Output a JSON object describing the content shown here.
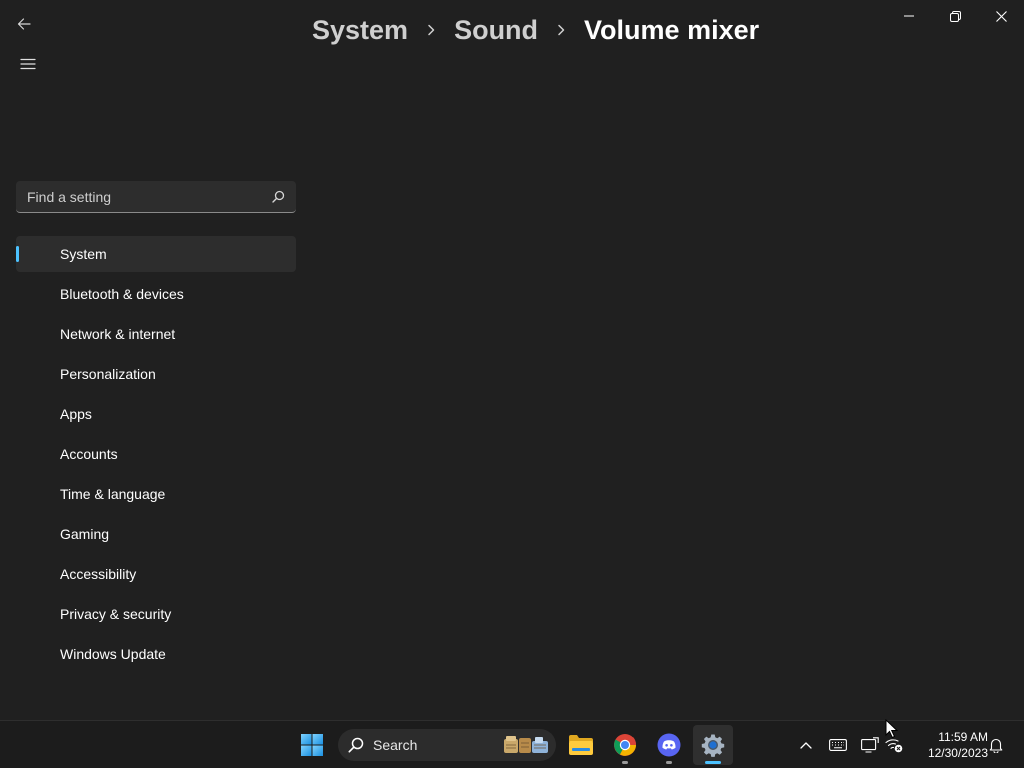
{
  "window": {
    "breadcrumb": [
      {
        "label": "System"
      },
      {
        "label": "Sound"
      },
      {
        "label": "Volume mixer"
      }
    ],
    "controls": [
      "minimize-icon",
      "restore-icon",
      "close-icon"
    ]
  },
  "search": {
    "placeholder": "Find a setting"
  },
  "nav": {
    "items": [
      {
        "label": "System",
        "selected": true
      },
      {
        "label": "Bluetooth & devices"
      },
      {
        "label": "Network & internet"
      },
      {
        "label": "Personalization"
      },
      {
        "label": "Apps"
      },
      {
        "label": "Accounts"
      },
      {
        "label": "Time & language"
      },
      {
        "label": "Gaming"
      },
      {
        "label": "Accessibility"
      },
      {
        "label": "Privacy & security"
      },
      {
        "label": "Windows Update"
      }
    ]
  },
  "taskbar": {
    "search_label": "Search",
    "apps": [
      {
        "icon": "file-explorer-icon"
      },
      {
        "icon": "chrome-icon",
        "running": true
      },
      {
        "icon": "discord-icon",
        "running": true
      },
      {
        "icon": "settings-icon",
        "running": true,
        "active": true
      }
    ],
    "tray": [
      "chevron-up-icon",
      "keyboard-icon",
      "display-icon",
      "network-disconnected-icon",
      "bell-icon"
    ],
    "clock": {
      "time": "11:59 AM",
      "date": "12/30/2023"
    }
  },
  "colors": {
    "background": "#202020",
    "taskbar": "#1c1c1c",
    "accent": "#4cc2ff",
    "selected_item": "#2d2d2d"
  }
}
